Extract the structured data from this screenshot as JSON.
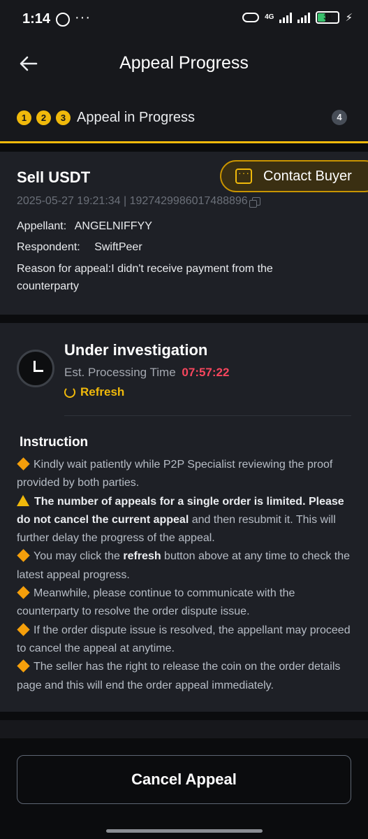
{
  "status_bar": {
    "time": "1:14",
    "network": "4G",
    "battery": "31"
  },
  "header": {
    "title": "Appeal Progress"
  },
  "steps": {
    "done": [
      "1",
      "2",
      "3"
    ],
    "current_label": "Appeal in Progress",
    "next": "4"
  },
  "order": {
    "type": "Sell USDT",
    "datetime": "2025-05-27 19:21:34",
    "order_id": "1927429986017488896",
    "appellant_label": "Appellant:",
    "appellant": "ANGELNIFFYY",
    "respondent_label": "Respondent:",
    "respondent": "SwiftPeer",
    "reason": "Reason for appeal:I didn't receive payment from the counterparty",
    "contact_label": "Contact Buyer"
  },
  "status": {
    "title": "Under investigation",
    "time_label": "Est. Processing Time",
    "countdown": "07:57:22",
    "refresh_label": "Refresh"
  },
  "instruction": {
    "title": "Instruction",
    "item1": "Kindly wait patiently while P2P Specialist reviewing the proof provided by both parties.",
    "warn_bold": "The number of appeals for a single order is limited. Please do not cancel the current appeal",
    "warn_rest": " and then resubmit it. This will further delay the progress of the appeal.",
    "item3_a": "You may click the ",
    "item3_bold": "refresh",
    "item3_b": " button above at any time to check the latest appeal progress.",
    "item4": "Meanwhile, please continue to communicate with the counterparty to resolve the order dispute issue.",
    "item5": "If the order dispute issue is resolved, the appellant may proceed to cancel the appeal at anytime.",
    "item6": "The seller has the right to release the coin on the order details page and this will end the order appeal immediately."
  },
  "footer": {
    "cancel_label": "Cancel Appeal"
  },
  "colors": {
    "accent": "#f0b90b",
    "countdown": "#f6465d",
    "background": "#17181c"
  }
}
